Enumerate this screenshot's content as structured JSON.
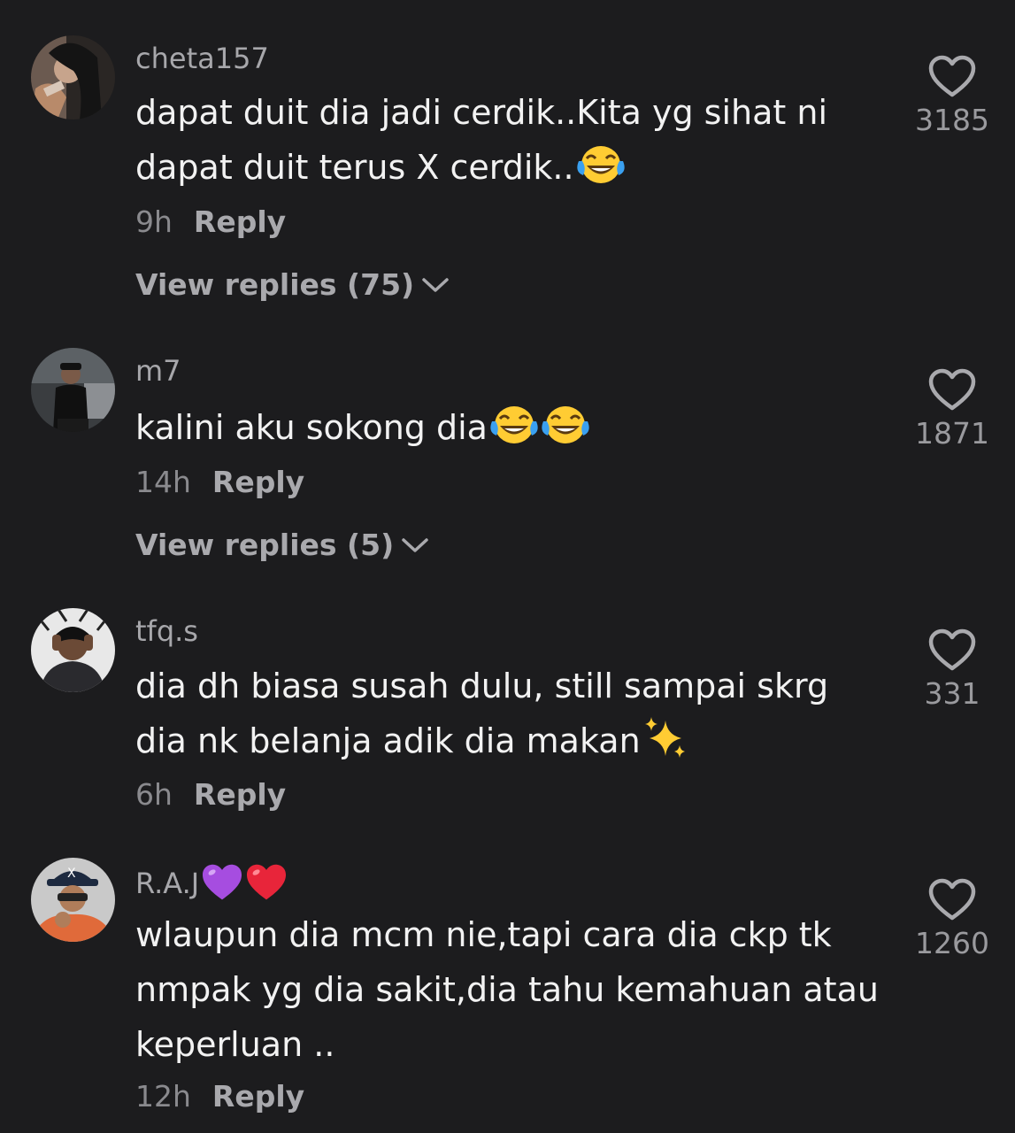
{
  "comments": [
    {
      "username": "cheta157",
      "text": "dapat duit dia jadi cerdik..Kita yg sihat ni dapat duit terus X cerdik..",
      "text_emoji": [
        "face-with-tears-of-joy"
      ],
      "time": "9h",
      "reply_label": "Reply",
      "view_replies": "View replies (75)",
      "likes": "3185"
    },
    {
      "username": "m7",
      "text": "kalini aku sokong dia",
      "text_emoji": [
        "face-with-tears-of-joy",
        "face-with-tears-of-joy"
      ],
      "time": "14h",
      "reply_label": "Reply",
      "view_replies": "View replies (5)",
      "likes": "1871"
    },
    {
      "username": "tfq.s",
      "text": "dia dh biasa susah dulu, still sampai skrg dia nk belanja adik dia makan",
      "text_emoji": [
        "sparkles"
      ],
      "time": "6h",
      "reply_label": "Reply",
      "likes": "331"
    },
    {
      "username": "R.A.J",
      "username_emoji": [
        "purple-heart",
        "red-heart"
      ],
      "text": "wlaupun dia mcm nie,tapi cara dia ckp tk nmpak yg dia sakit,dia tahu kemahuan atau keperluan ..",
      "time": "12h",
      "reply_label": "Reply",
      "likes": "1260"
    }
  ],
  "colors": {
    "background": "#1c1c1e",
    "text": "#f2f2f2",
    "muted": "#a7a7ab",
    "emoji_yellow": "#ffcc33",
    "purple_heart": "#a64de0",
    "red_heart": "#e8253a"
  }
}
